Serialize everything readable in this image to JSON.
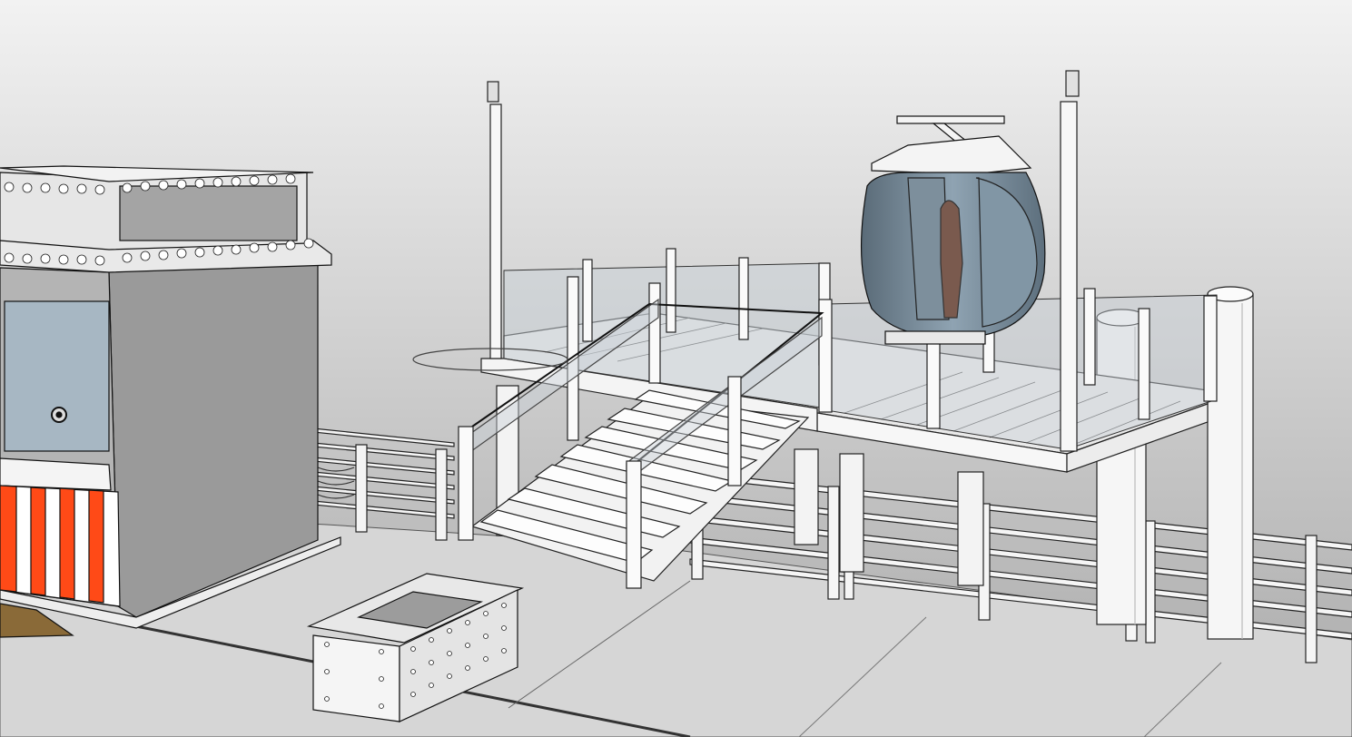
{
  "scene": {
    "kind": "3D model viewport",
    "objects": [
      "ticket-booth",
      "boarding-platform",
      "staircase",
      "gondola-cabin",
      "light-pole",
      "utility-box",
      "railing",
      "bollard-pillar"
    ]
  },
  "colors": {
    "sky_top": "#f2f2f2",
    "sky_bottom": "#a9a9a9",
    "ground": "#d6d6d6",
    "booth_wall": "#9a9a9a",
    "booth_stripe_red": "#ff4a17",
    "glass": "#a7b7c3",
    "cabin_glass": "#6f8494",
    "line": "#1a1a1a"
  },
  "icons": {
    "booth_lock": "lock-dial-icon"
  }
}
